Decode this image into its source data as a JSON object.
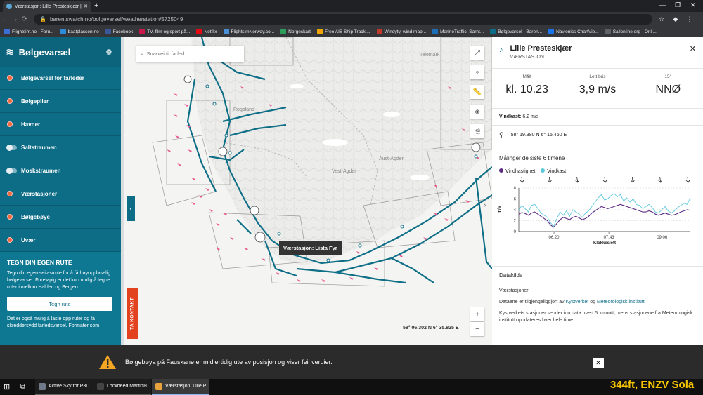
{
  "browser": {
    "tab_title": "Værstasjon: Lille Presteskjær | Bø",
    "url": "barentswatch.no/bolgevarsel/weatherstation/5725049",
    "bookmarks": [
      {
        "label": "Flightsim.no - Foru...",
        "color": "#3b6fd6"
      },
      {
        "label": "baatplassen.no",
        "color": "#2c8ad6"
      },
      {
        "label": "Facebook",
        "color": "#3b5998"
      },
      {
        "label": "TV, film og sport på...",
        "color": "#c9184a"
      },
      {
        "label": "Netflix",
        "color": "#e50914"
      },
      {
        "label": "FlightsimNorway.co...",
        "color": "#4a90d9"
      },
      {
        "label": "Norgeskart",
        "color": "#2e9d5b"
      },
      {
        "label": "Free AIS Ship Tracki...",
        "color": "#f0a500"
      },
      {
        "label": "Windyty, wind map...",
        "color": "#c0392b"
      },
      {
        "label": "MarineTraffic: Sarnt...",
        "color": "#1d6fb8"
      },
      {
        "label": "Bølgevarsel - Baren...",
        "color": "#0d6c86"
      },
      {
        "label": "Navionics ChartVie...",
        "color": "#1a73e8"
      },
      {
        "label": "Sailonline.org - Onli...",
        "color": "#5f6368"
      }
    ]
  },
  "sidebar": {
    "brand": "Bølgevarsel",
    "menu": [
      {
        "label": "Bølgevarsel for farleder",
        "kind": "dot"
      },
      {
        "label": "Bølgepiler",
        "kind": "dot"
      },
      {
        "label": "Havner",
        "kind": "dot"
      },
      {
        "label": "Saltstraumen",
        "kind": "toggle"
      },
      {
        "label": "Moskstraumen",
        "kind": "toggle"
      },
      {
        "label": "Værstasjoner",
        "kind": "dot"
      },
      {
        "label": "Bølgebøye",
        "kind": "dot"
      },
      {
        "label": "Uvær",
        "kind": "dot"
      }
    ],
    "route": {
      "heading": "TEGN DIN EGEN RUTE",
      "text1": "Tegn din egen seilas/rute for å få høyoppløselig bølgevarsel. Foreløpig er det kun mulig å tegne ruter i mellom Halden og Bergen.",
      "button": "Tegn rute",
      "text2": "Det er også mulig å laste opp ruter og få skreddersydd farledsvarsel. Formater som"
    }
  },
  "map": {
    "search_placeholder": "Snarvei til farled",
    "kontakt": "TA KONTAKT",
    "coordinates": "58° 06.302 N 6° 35.825 E",
    "tooltip": "Værstasjon: Lista Fyr",
    "places": [
      "Rogaland",
      "Vest-Agder",
      "Aust-Agder",
      "Telemark"
    ]
  },
  "panel": {
    "title": "Lille Presteskjær",
    "subtitle": "VÆRSTASJON",
    "stats": [
      {
        "label": "Målt",
        "value": "kl. 10.23"
      },
      {
        "label": "Lett bris",
        "value": "3,9 m/s"
      },
      {
        "label": "15°",
        "value": "NNØ"
      }
    ],
    "gust_label": "Vindkast:",
    "gust_value": "6.2 m/s",
    "position": "58° 19.380 N 6° 15.460 E",
    "chart_title": "Målinger de siste 6 timene",
    "legend_speed": "Vindhastighet",
    "legend_gust": "Vindkast",
    "datakilde": "Datakilde",
    "source_heading": "Værstasjoner",
    "source_text_a": "Dataene er tilgjengeliggjort av",
    "source_link1": "Kystverket",
    "source_and": "og",
    "source_link2": "Meteorologisk institutt",
    "source_text_b": "Kystverkets stasjoner sender inn data hvert 5. minutt, mens stasjonene fra Meteorologisk institutt oppdateres hver hele time."
  },
  "banner": {
    "text": "Bølgebøya på Fauskane er midlertidig ute av posisjon og viser feil verdier."
  },
  "taskbar": {
    "apps": [
      {
        "label": "Active Sky for P3Dv...",
        "color": "#6e7a8a"
      },
      {
        "label": "Lockheed Martin®...",
        "color": "#444"
      },
      {
        "label": "Værstasjon: Lille Pr...",
        "color": "#e8a33d"
      }
    ]
  },
  "overlay_text": "344ft, ENZV Sola",
  "colors": {
    "accent": "#0d6c86",
    "speed": "#5b2c83",
    "gust": "#5cc8dc",
    "warn": "#f5a623"
  },
  "chart_data": {
    "type": "line",
    "ylabel": "m/s",
    "xlabel": "Klokkeslett",
    "ylim": [
      0,
      8
    ],
    "yticks": [
      0,
      2,
      4,
      6,
      8
    ],
    "xtick_labels": [
      "06.20",
      "07.43",
      "09.06"
    ],
    "xtick_positions": [
      0.205,
      0.525,
      0.835
    ],
    "series": [
      {
        "name": "Vindhastighet",
        "values": [
          3.2,
          3.5,
          3.3,
          3.0,
          3.4,
          3.6,
          3.2,
          2.8,
          2.4,
          2.0,
          1.2,
          0.8,
          1.5,
          2.2,
          2.6,
          2.4,
          2.2,
          2.6,
          2.8,
          2.5,
          2.2,
          2.4,
          2.8,
          3.4,
          3.8,
          4.2,
          4.6,
          4.4,
          4.2,
          4.4,
          4.6,
          4.8,
          5.0,
          4.8,
          4.6,
          4.4,
          4.2,
          4.0,
          3.8,
          3.6,
          3.6,
          3.8,
          3.6,
          3.2,
          3.0,
          3.2,
          3.4,
          3.2,
          3.0,
          3.1,
          3.3,
          3.6,
          3.8,
          4.0,
          3.9
        ]
      },
      {
        "name": "Vindkast",
        "values": [
          4.0,
          4.8,
          4.2,
          3.6,
          4.8,
          5.0,
          4.2,
          3.4,
          3.0,
          2.6,
          1.6,
          1.0,
          2.4,
          3.6,
          3.0,
          3.8,
          2.8,
          4.0,
          3.6,
          3.2,
          2.6,
          3.4,
          3.8,
          4.6,
          5.4,
          6.2,
          6.8,
          5.8,
          6.0,
          6.6,
          7.0,
          6.4,
          6.8,
          5.6,
          6.2,
          5.4,
          6.0,
          5.0,
          4.8,
          4.2,
          4.6,
          5.0,
          4.4,
          3.6,
          3.4,
          4.0,
          4.6,
          3.8,
          3.4,
          3.8,
          4.4,
          4.8,
          5.2,
          5.0,
          6.2
        ]
      }
    ],
    "arrows_count": 7
  }
}
